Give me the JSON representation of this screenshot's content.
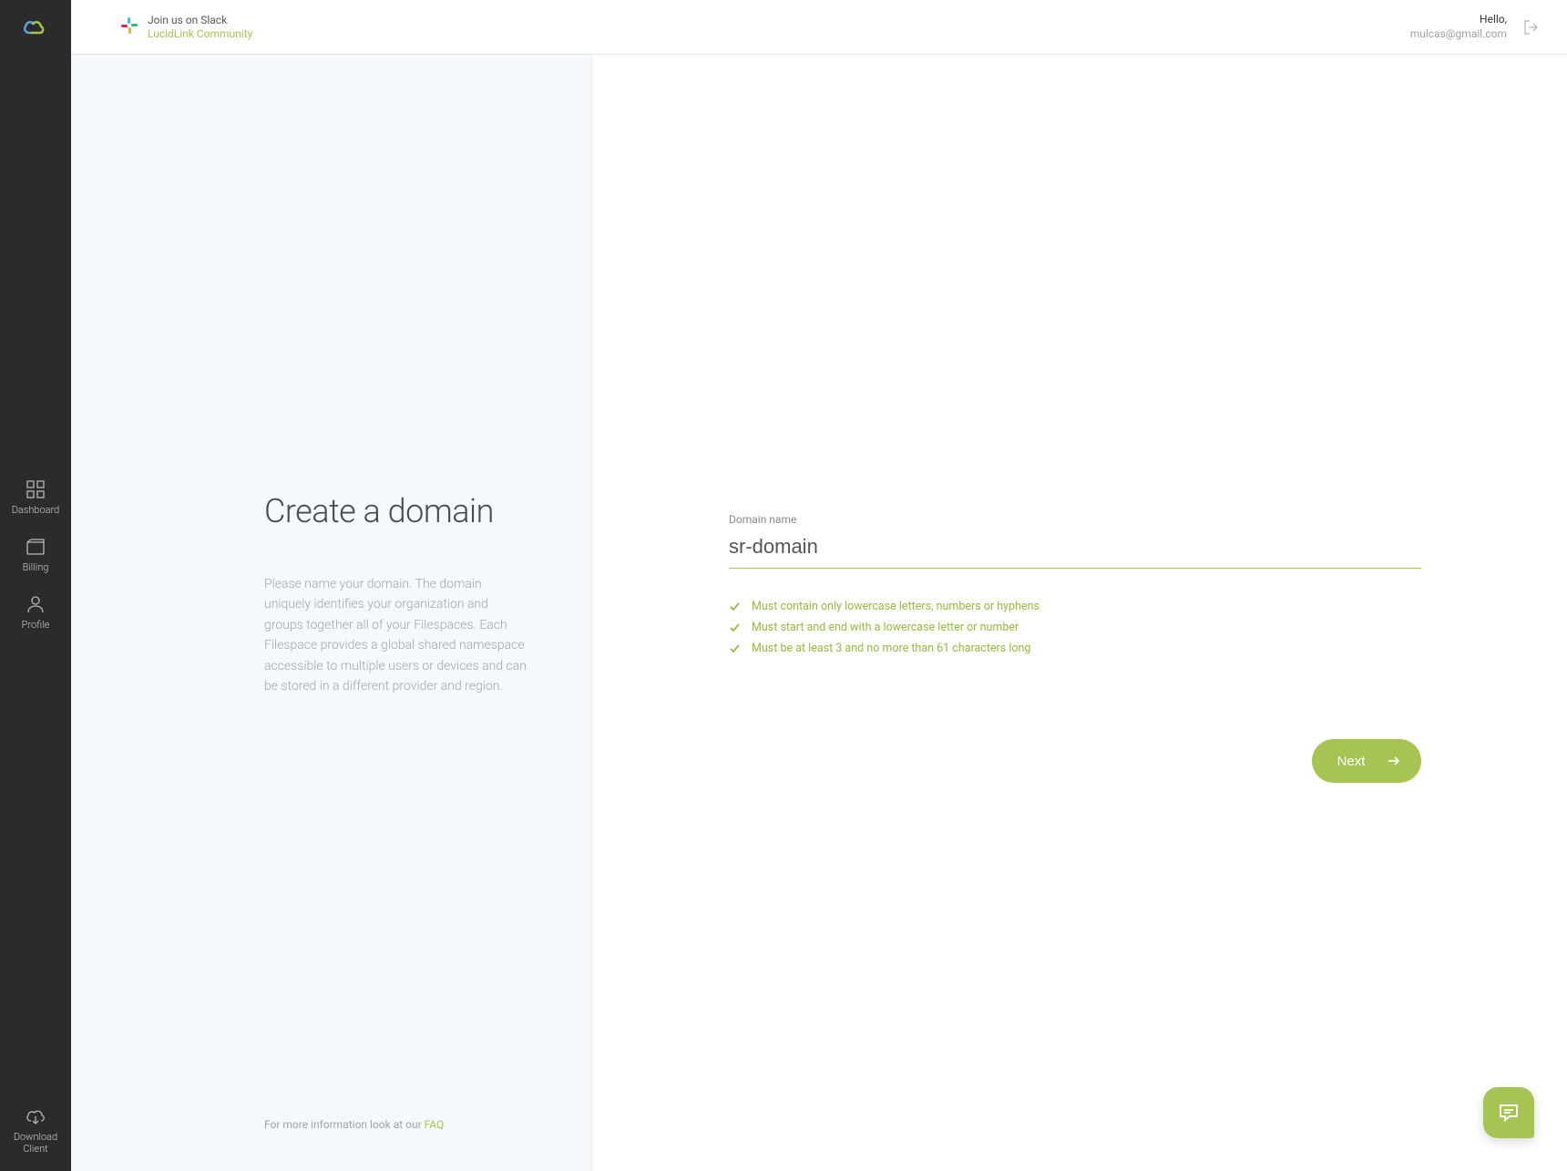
{
  "sidebar": {
    "nav": [
      {
        "label": "Dashboard",
        "icon": "grid"
      },
      {
        "label": "Billing",
        "icon": "wallet"
      },
      {
        "label": "Profile",
        "icon": "user"
      }
    ],
    "bottom": {
      "label": "Download\nClient",
      "icon": "download"
    }
  },
  "header": {
    "slack_line1": "Join us on Slack",
    "slack_line2": "LucidLink Community",
    "user_hello": "Hello,",
    "user_email": "mulcas@gmail.com"
  },
  "left": {
    "title": "Create a domain",
    "description": "Please name your domain. The domain uniquely identifies your organization and groups together all of your Filespaces. Each Filespace provides a global shared namespace accessible to multiple users or devices and can be stored in a different provider and region.",
    "footer_text": "For more information look at our ",
    "footer_link": "FAQ"
  },
  "form": {
    "field_label": "Domain name",
    "domain_value": "sr-domain",
    "rules": [
      "Must contain only lowercase letters, numbers or hyphens",
      "Must start and end with a lowercase letter or number",
      "Must be at least 3 and no more than 61 characters long"
    ],
    "next_label": "Next"
  }
}
